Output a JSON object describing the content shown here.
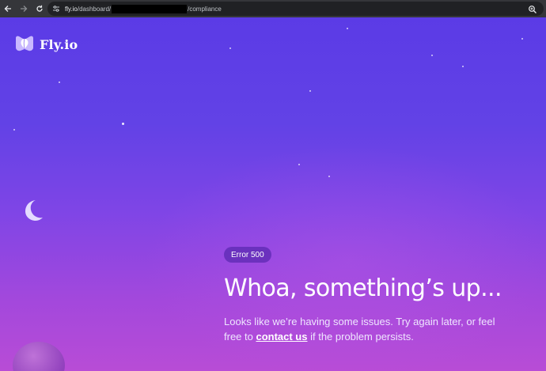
{
  "browser": {
    "url_host": "fly.io",
    "url_path_start": "/dashboard/",
    "url_path_end": "/compliance"
  },
  "brand": {
    "name": "Fly.io"
  },
  "error": {
    "badge": "Error 500",
    "headline": "Whoa, something’s up...",
    "message_before": "Looks like we’re having some issues. Try again later, or feel free to ",
    "link_text": "contact us",
    "message_after": " if the problem persists."
  },
  "icons": [
    "back-icon",
    "forward-icon",
    "reload-icon",
    "site-settings-icon",
    "zoom-icon",
    "fly-logo-icon",
    "moon-icon"
  ],
  "colors": {
    "gradient_top": "#5b3be6",
    "gradient_bottom": "#b84cd6",
    "badge_bg": "#4a2aa8",
    "text": "#ffffff"
  }
}
